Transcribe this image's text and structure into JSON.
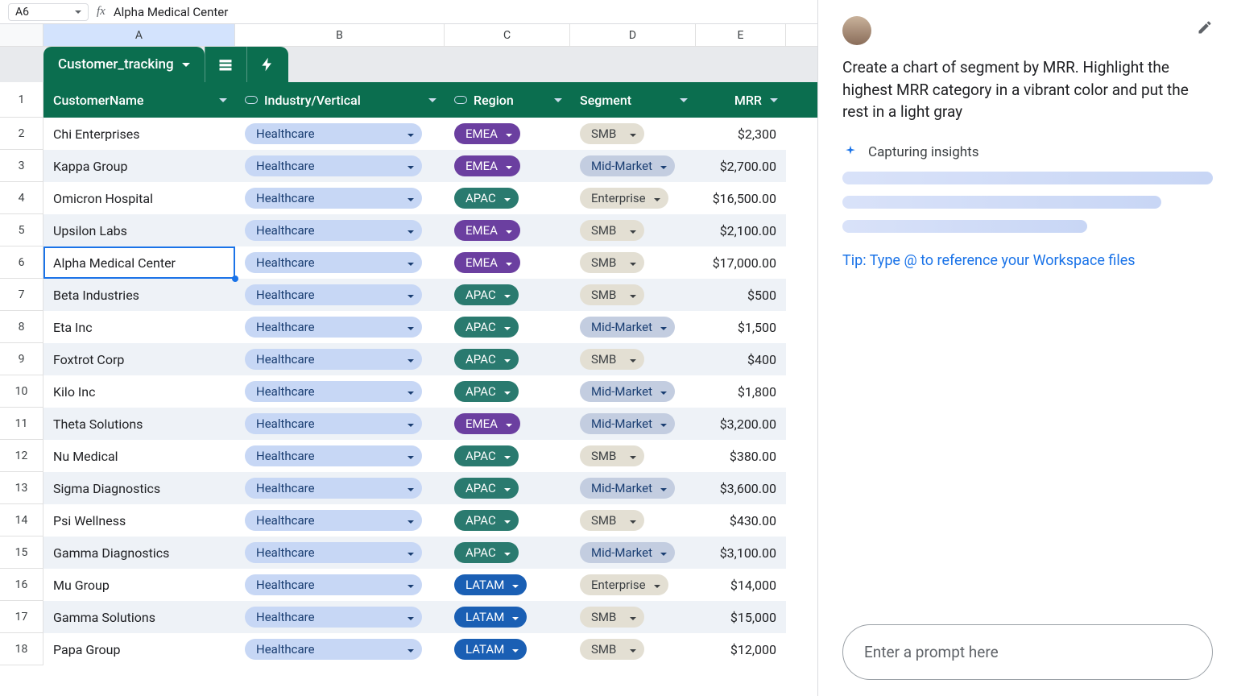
{
  "cellRef": "A6",
  "formulaValue": "Alpha Medical Center",
  "columns": [
    "A",
    "B",
    "C",
    "D",
    "E"
  ],
  "tableTab": "Customer_tracking",
  "headers": {
    "name": "CustomerName",
    "industry": "Industry/Vertical",
    "region": "Region",
    "segment": "Segment",
    "mrr": "MRR"
  },
  "rows": [
    {
      "n": "2",
      "name": "Chi Enterprises",
      "ind": "Healthcare",
      "reg": "EMEA",
      "seg": "SMB",
      "mrr": "$2,300"
    },
    {
      "n": "3",
      "name": "Kappa Group",
      "ind": "Healthcare",
      "reg": "EMEA",
      "seg": "Mid-Market",
      "mrr": "$2,700.00"
    },
    {
      "n": "4",
      "name": "Omicron Hospital",
      "ind": "Healthcare",
      "reg": "APAC",
      "seg": "Enterprise",
      "mrr": "$16,500.00"
    },
    {
      "n": "5",
      "name": "Upsilon Labs",
      "ind": "Healthcare",
      "reg": "EMEA",
      "seg": "SMB",
      "mrr": "$2,100.00"
    },
    {
      "n": "6",
      "name": "Alpha Medical Center",
      "ind": "Healthcare",
      "reg": "EMEA",
      "seg": "SMB",
      "mrr": "$17,000.00"
    },
    {
      "n": "7",
      "name": "Beta Industries",
      "ind": "Healthcare",
      "reg": "APAC",
      "seg": "SMB",
      "mrr": "$500"
    },
    {
      "n": "8",
      "name": "Eta Inc",
      "ind": "Healthcare",
      "reg": "APAC",
      "seg": "Mid-Market",
      "mrr": "$1,500"
    },
    {
      "n": "9",
      "name": "Foxtrot Corp",
      "ind": "Healthcare",
      "reg": "APAC",
      "seg": "SMB",
      "mrr": "$400"
    },
    {
      "n": "10",
      "name": "Kilo Inc",
      "ind": "Healthcare",
      "reg": "APAC",
      "seg": "Mid-Market",
      "mrr": "$1,800"
    },
    {
      "n": "11",
      "name": "Theta Solutions",
      "ind": "Healthcare",
      "reg": "EMEA",
      "seg": "Mid-Market",
      "mrr": "$3,200.00"
    },
    {
      "n": "12",
      "name": "Nu Medical",
      "ind": "Healthcare",
      "reg": "APAC",
      "seg": "SMB",
      "mrr": "$380.00"
    },
    {
      "n": "13",
      "name": "Sigma Diagnostics",
      "ind": "Healthcare",
      "reg": "APAC",
      "seg": "Mid-Market",
      "mrr": "$3,600.00"
    },
    {
      "n": "14",
      "name": "Psi Wellness",
      "ind": "Healthcare",
      "reg": "APAC",
      "seg": "SMB",
      "mrr": "$430.00"
    },
    {
      "n": "15",
      "name": "Gamma Diagnostics",
      "ind": "Healthcare",
      "reg": "APAC",
      "seg": "Mid-Market",
      "mrr": "$3,100.00"
    },
    {
      "n": "16",
      "name": "Mu Group",
      "ind": "Healthcare",
      "reg": "LATAM",
      "seg": "Enterprise",
      "mrr": "$14,000"
    },
    {
      "n": "17",
      "name": "Gamma Solutions",
      "ind": "Healthcare",
      "reg": "LATAM",
      "seg": "SMB",
      "mrr": "$15,000"
    },
    {
      "n": "18",
      "name": "Papa Group",
      "ind": "Healthcare",
      "reg": "LATAM",
      "seg": "SMB",
      "mrr": "$12,000"
    }
  ],
  "headerRowNum": "1",
  "selectedRow": "6",
  "side": {
    "prompt": "Create a chart of segment by MRR. Highlight the highest MRR category in a vibrant color and put the rest in a light gray",
    "status": "Capturing insights",
    "tip": "Tip: Type @ to reference your Workspace files",
    "placeholder": "Enter a prompt here"
  },
  "regionClass": {
    "EMEA": "pill-emea",
    "APAC": "pill-apac",
    "LATAM": "pill-latam"
  },
  "segClass": {
    "SMB": "pill-smb",
    "Mid-Market": "pill-mid",
    "Enterprise": "pill-ent"
  }
}
